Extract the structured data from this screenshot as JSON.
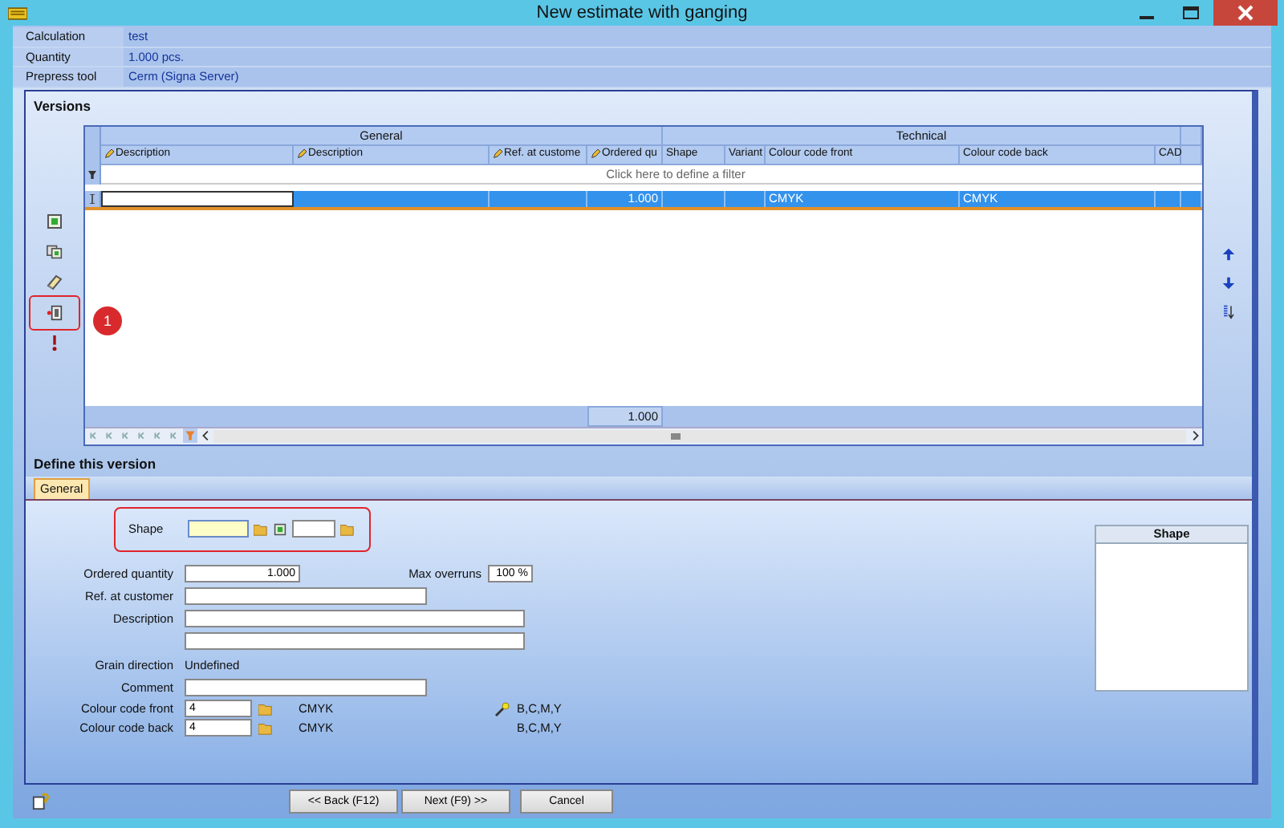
{
  "window": {
    "title": "New estimate with ganging"
  },
  "info": [
    {
      "label": "Calculation",
      "value": "test"
    },
    {
      "label": "Quantity",
      "value": "1.000 pcs."
    },
    {
      "label": "Prepress tool",
      "value": "Cerm (Signa Server)"
    }
  ],
  "versions": {
    "title": "Versions",
    "left_tools": [
      {
        "kind": "add",
        "highlighted": false
      },
      {
        "kind": "copy",
        "highlighted": false
      },
      {
        "kind": "erase",
        "highlighted": false
      },
      {
        "kind": "import",
        "highlighted": true,
        "annotation": "1"
      },
      {
        "kind": "mark",
        "highlighted": false
      }
    ],
    "right_tools": [
      {
        "kind": "up"
      },
      {
        "kind": "down"
      },
      {
        "kind": "sort"
      }
    ],
    "grid": {
      "groups": [
        {
          "label": "General",
          "columns": [
            {
              "label": "Description",
              "editable": true
            },
            {
              "label": "Description",
              "editable": true
            },
            {
              "label": "Ref. at custome",
              "editable": true
            },
            {
              "label": "Ordered qu",
              "editable": true
            }
          ]
        },
        {
          "label": "Technical",
          "columns": [
            {
              "label": "Shape",
              "editable": false
            },
            {
              "label": "Variant",
              "editable": false
            },
            {
              "label": "Colour code front",
              "editable": false
            },
            {
              "label": "Colour code back",
              "editable": false
            },
            {
              "label": "CAD",
              "editable": false
            }
          ]
        }
      ],
      "filter_hint": "Click here to define a filter",
      "rows": [
        {
          "selected": true,
          "ordered_quantity": "1.000",
          "colour_code_front": "CMYK",
          "colour_code_back": "CMYK"
        }
      ],
      "totals": {
        "ordered_quantity": "1.000"
      }
    }
  },
  "define": {
    "title": "Define this version",
    "tabs": [
      {
        "label": "General",
        "selected": true
      }
    ],
    "shape": {
      "label": "Shape",
      "highlighted": true
    },
    "ordered_quantity": {
      "label": "Ordered quantity",
      "value": "1.000"
    },
    "max_overruns": {
      "label": "Max overruns",
      "value": "100 %"
    },
    "ref_at_customer": {
      "label": "Ref. at customer"
    },
    "description": {
      "label": "Description"
    },
    "grain_direction": {
      "label": "Grain direction",
      "value": "Undefined"
    },
    "comment": {
      "label": "Comment"
    },
    "colour_codes": [
      {
        "label": "Colour code front",
        "value": "4",
        "name": "CMYK",
        "sequence": "B,C,M,Y",
        "wand": true
      },
      {
        "label": "Colour code back",
        "value": "4",
        "name": "CMYK",
        "sequence": "B,C,M,Y",
        "wand": false
      }
    ],
    "preview": {
      "title": "Shape"
    }
  },
  "buttons": [
    "<< Back (F12)",
    "Next (F9) >>",
    "Cancel"
  ]
}
